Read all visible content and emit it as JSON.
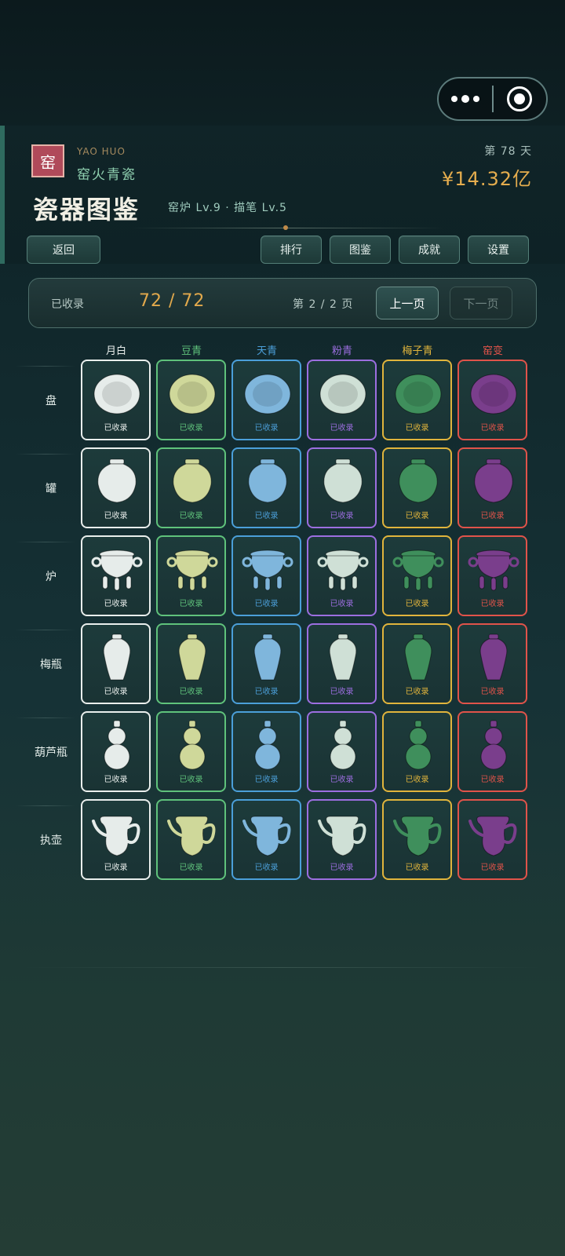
{
  "header": {
    "seal": "窑",
    "brand_en": "YAO HUO",
    "brand_cn": "窑火青瓷",
    "title": "瓷器图鉴",
    "levels": "窑炉 Lv.9 · 描笔 Lv.5",
    "day": "第 78 天",
    "money": "¥14.32亿"
  },
  "nav": {
    "back": "返回",
    "rank": "排行",
    "catalog": "图鉴",
    "achievement": "成就",
    "settings": "设置"
  },
  "status": {
    "label": "已收录",
    "count": "72 / 72",
    "page": "第 2 / 2 页",
    "prev": "上一页",
    "next": "下一页"
  },
  "glazes": [
    {
      "name": "月白",
      "color": "#e9eeec"
    },
    {
      "name": "豆青",
      "color": "#5fc27b"
    },
    {
      "name": "天青",
      "color": "#4b9fd9"
    },
    {
      "name": "粉青",
      "color": "#9c6ee0"
    },
    {
      "name": "梅子青",
      "color": "#e0b43c"
    },
    {
      "name": "窑变",
      "color": "#e0534a"
    }
  ],
  "shapes": [
    {
      "name": "盘",
      "icon": "plate-icon"
    },
    {
      "name": "罐",
      "icon": "jar-icon"
    },
    {
      "name": "炉",
      "icon": "censer-icon"
    },
    {
      "name": "梅瓶",
      "icon": "meiping-vase-icon"
    },
    {
      "name": "葫芦瓶",
      "icon": "gourd-vase-icon"
    },
    {
      "name": "执壶",
      "icon": "ewer-icon"
    }
  ],
  "collected_label": "已收录",
  "piece_fill_colors": [
    "#e6ecea",
    "#cfd89a",
    "#7fb6dc",
    "#cfe0d6",
    "#3f8f5c",
    "#7a3e8c"
  ]
}
